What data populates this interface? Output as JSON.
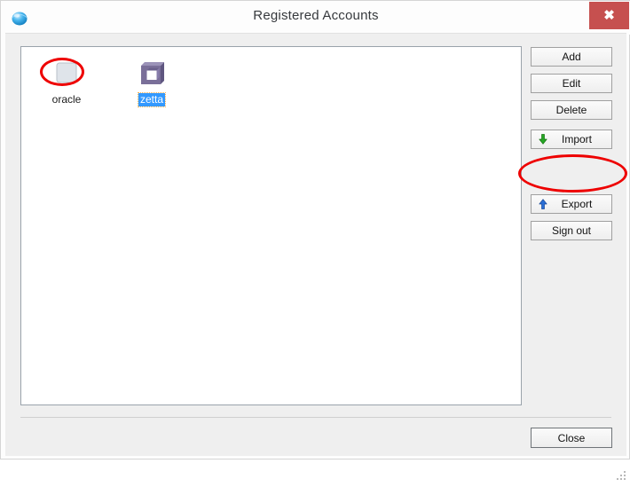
{
  "window": {
    "title": "Registered Accounts",
    "app_icon": "globe-icon",
    "close_label": "✖"
  },
  "accounts": {
    "items": [
      {
        "name": "oracle",
        "icon": "account-icon",
        "selected": false
      },
      {
        "name": "zetta",
        "icon": "cube-icon",
        "selected": true
      }
    ]
  },
  "side_buttons": [
    {
      "label": "Add",
      "icon": null
    },
    {
      "label": "Edit",
      "icon": null
    },
    {
      "label": "Delete",
      "icon": null
    },
    {
      "label": "Import",
      "icon": "arrow-down-icon"
    },
    {
      "label": "Export",
      "icon": "arrow-up-icon"
    },
    {
      "label": "Sign out",
      "icon": null
    }
  ],
  "footer": {
    "close_label": "Close"
  },
  "annotations": [
    {
      "target": "oracle-account-icon",
      "shape": "ellipse",
      "color": "#ee0000"
    },
    {
      "target": "export-button",
      "shape": "ellipse",
      "color": "#ee0000"
    }
  ],
  "colors": {
    "close_button": "#c6504f",
    "selection": "#3399ff",
    "annotation": "#ee0000",
    "cube_icon": "#7a6f99",
    "import_arrow": "#25a625",
    "export_arrow": "#2a6fd6"
  }
}
